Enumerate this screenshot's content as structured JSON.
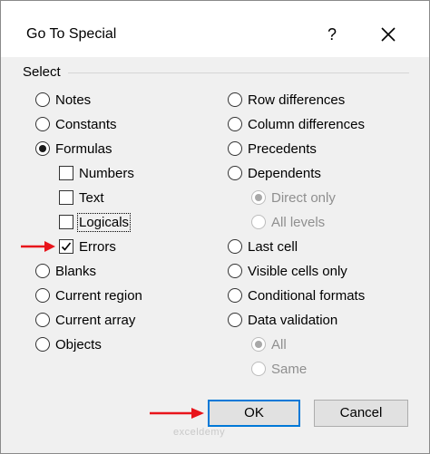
{
  "dialog": {
    "title": "Go To Special",
    "help_glyph": "?",
    "group_label": "Select"
  },
  "left_options": [
    {
      "label": "Notes",
      "checked": false
    },
    {
      "label": "Constants",
      "checked": false
    },
    {
      "label": "Formulas",
      "checked": true
    },
    {
      "label": "Blanks",
      "checked": false
    },
    {
      "label": "Current region",
      "checked": false
    },
    {
      "label": "Current array",
      "checked": false
    },
    {
      "label": "Objects",
      "checked": false
    }
  ],
  "formula_checkboxes": [
    {
      "label": "Numbers",
      "checked": false
    },
    {
      "label": "Text",
      "checked": false
    },
    {
      "label": "Logicals",
      "checked": false
    },
    {
      "label": "Errors",
      "checked": true
    }
  ],
  "right_options": [
    {
      "label": "Row differences",
      "checked": false
    },
    {
      "label": "Column differences",
      "checked": false
    },
    {
      "label": "Precedents",
      "checked": false
    },
    {
      "label": "Dependents",
      "checked": false
    },
    {
      "label": "Last cell",
      "checked": false
    },
    {
      "label": "Visible cells only",
      "checked": false
    },
    {
      "label": "Conditional formats",
      "checked": false
    },
    {
      "label": "Data validation",
      "checked": false
    }
  ],
  "dependents_sub": [
    {
      "label": "Direct only",
      "checked": true,
      "disabled": true
    },
    {
      "label": "All levels",
      "checked": false,
      "disabled": true
    }
  ],
  "validation_sub": [
    {
      "label": "All",
      "checked": true,
      "disabled": true
    },
    {
      "label": "Same",
      "checked": false,
      "disabled": true
    }
  ],
  "buttons": {
    "ok": "OK",
    "cancel": "Cancel"
  },
  "watermark": "exceldemy",
  "colors": {
    "annotation_arrow": "#e8141b",
    "default_button_border": "#0078d7"
  }
}
